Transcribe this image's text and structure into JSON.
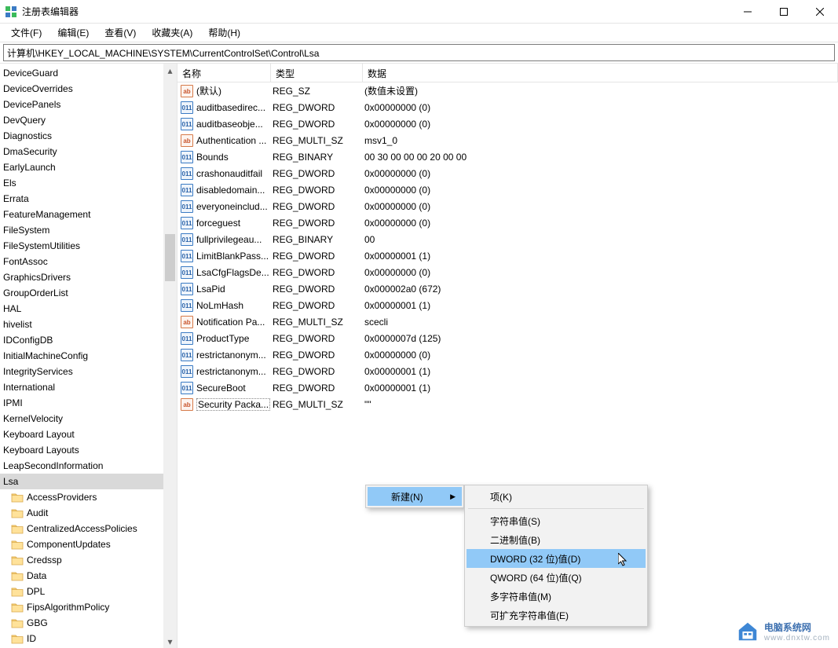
{
  "window": {
    "title": "注册表编辑器"
  },
  "menubar": [
    "文件(F)",
    "编辑(E)",
    "查看(V)",
    "收藏夹(A)",
    "帮助(H)"
  ],
  "address": "计算机\\HKEY_LOCAL_MACHINE\\SYSTEM\\CurrentControlSet\\Control\\Lsa",
  "columns": {
    "name": "名称",
    "type": "类型",
    "data": "数据"
  },
  "tree": [
    {
      "label": "DeviceGuard",
      "lvl": 1
    },
    {
      "label": "DeviceOverrides",
      "lvl": 1
    },
    {
      "label": "DevicePanels",
      "lvl": 1
    },
    {
      "label": "DevQuery",
      "lvl": 1
    },
    {
      "label": "Diagnostics",
      "lvl": 1
    },
    {
      "label": "DmaSecurity",
      "lvl": 1
    },
    {
      "label": "EarlyLaunch",
      "lvl": 1
    },
    {
      "label": "Els",
      "lvl": 1
    },
    {
      "label": "Errata",
      "lvl": 1
    },
    {
      "label": "FeatureManagement",
      "lvl": 1
    },
    {
      "label": "FileSystem",
      "lvl": 1
    },
    {
      "label": "FileSystemUtilities",
      "lvl": 1
    },
    {
      "label": "FontAssoc",
      "lvl": 1
    },
    {
      "label": "GraphicsDrivers",
      "lvl": 1
    },
    {
      "label": "GroupOrderList",
      "lvl": 1
    },
    {
      "label": "HAL",
      "lvl": 1
    },
    {
      "label": "hivelist",
      "lvl": 1
    },
    {
      "label": "IDConfigDB",
      "lvl": 1
    },
    {
      "label": "InitialMachineConfig",
      "lvl": 1
    },
    {
      "label": "IntegrityServices",
      "lvl": 1
    },
    {
      "label": "International",
      "lvl": 1
    },
    {
      "label": "IPMI",
      "lvl": 1
    },
    {
      "label": "KernelVelocity",
      "lvl": 1
    },
    {
      "label": "Keyboard Layout",
      "lvl": 1
    },
    {
      "label": "Keyboard Layouts",
      "lvl": 1
    },
    {
      "label": "LeapSecondInformation",
      "lvl": 1
    },
    {
      "label": "Lsa",
      "lvl": 1,
      "selected": true
    },
    {
      "label": "AccessProviders",
      "lvl": 2
    },
    {
      "label": "Audit",
      "lvl": 2
    },
    {
      "label": "CentralizedAccessPolicies",
      "lvl": 2
    },
    {
      "label": "ComponentUpdates",
      "lvl": 2
    },
    {
      "label": "Credssp",
      "lvl": 2
    },
    {
      "label": "Data",
      "lvl": 2
    },
    {
      "label": "DPL",
      "lvl": 2
    },
    {
      "label": "FipsAlgorithmPolicy",
      "lvl": 2
    },
    {
      "label": "GBG",
      "lvl": 2
    },
    {
      "label": "ID",
      "lvl": 2
    }
  ],
  "values": [
    {
      "icon": "str",
      "name": "(默认)",
      "type": "REG_SZ",
      "data": "(数值未设置)"
    },
    {
      "icon": "bin",
      "name": "auditbasedirec...",
      "type": "REG_DWORD",
      "data": "0x00000000 (0)"
    },
    {
      "icon": "bin",
      "name": "auditbaseobje...",
      "type": "REG_DWORD",
      "data": "0x00000000 (0)"
    },
    {
      "icon": "str",
      "name": "Authentication ...",
      "type": "REG_MULTI_SZ",
      "data": "msv1_0"
    },
    {
      "icon": "bin",
      "name": "Bounds",
      "type": "REG_BINARY",
      "data": "00 30 00 00 00 20 00 00"
    },
    {
      "icon": "bin",
      "name": "crashonauditfail",
      "type": "REG_DWORD",
      "data": "0x00000000 (0)"
    },
    {
      "icon": "bin",
      "name": "disabledomain...",
      "type": "REG_DWORD",
      "data": "0x00000000 (0)"
    },
    {
      "icon": "bin",
      "name": "everyoneinclud...",
      "type": "REG_DWORD",
      "data": "0x00000000 (0)"
    },
    {
      "icon": "bin",
      "name": "forceguest",
      "type": "REG_DWORD",
      "data": "0x00000000 (0)"
    },
    {
      "icon": "bin",
      "name": "fullprivilegeau...",
      "type": "REG_BINARY",
      "data": "00"
    },
    {
      "icon": "bin",
      "name": "LimitBlankPass...",
      "type": "REG_DWORD",
      "data": "0x00000001 (1)"
    },
    {
      "icon": "bin",
      "name": "LsaCfgFlagsDe...",
      "type": "REG_DWORD",
      "data": "0x00000000 (0)"
    },
    {
      "icon": "bin",
      "name": "LsaPid",
      "type": "REG_DWORD",
      "data": "0x000002a0 (672)"
    },
    {
      "icon": "bin",
      "name": "NoLmHash",
      "type": "REG_DWORD",
      "data": "0x00000001 (1)"
    },
    {
      "icon": "str",
      "name": "Notification Pa...",
      "type": "REG_MULTI_SZ",
      "data": "scecli"
    },
    {
      "icon": "bin",
      "name": "ProductType",
      "type": "REG_DWORD",
      "data": "0x0000007d (125)"
    },
    {
      "icon": "bin",
      "name": "restrictanonym...",
      "type": "REG_DWORD",
      "data": "0x00000000 (0)"
    },
    {
      "icon": "bin",
      "name": "restrictanonym...",
      "type": "REG_DWORD",
      "data": "0x00000001 (1)"
    },
    {
      "icon": "bin",
      "name": "SecureBoot",
      "type": "REG_DWORD",
      "data": "0x00000001 (1)"
    },
    {
      "icon": "str",
      "name": "Security Packa...",
      "type": "REG_MULTI_SZ",
      "data": "\"\"",
      "selected": true
    }
  ],
  "context": {
    "new": "新建(N)",
    "submenu": [
      {
        "label": "项(K)"
      },
      {
        "sep": true
      },
      {
        "label": "字符串值(S)"
      },
      {
        "label": "二进制值(B)"
      },
      {
        "label": "DWORD (32 位)值(D)",
        "highlight": true
      },
      {
        "label": "QWORD (64 位)值(Q)"
      },
      {
        "label": "多字符串值(M)"
      },
      {
        "label": "可扩充字符串值(E)"
      }
    ]
  },
  "watermark": {
    "text": "电脑系统网",
    "url": "www.dnxtw.com"
  }
}
